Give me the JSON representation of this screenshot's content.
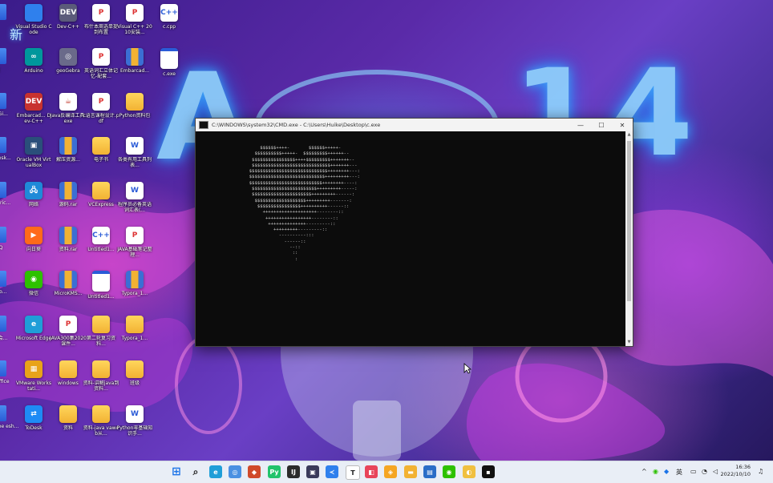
{
  "desktop": {
    "decorative_text": "新",
    "icons": [
      {
        "label": "Visual Studio Code",
        "icon": "vscode-icon",
        "color": "#2f80ed"
      },
      {
        "label": "Dev-C++",
        "icon": "devcpp-icon",
        "color": "#5b5b7a",
        "glyph": "DEV"
      },
      {
        "label": "布什本周选单提到布置",
        "icon": "pdf-document-icon",
        "color": "#ffffff",
        "glyph": "P"
      },
      {
        "label": "Visual C++ 2010安装...",
        "icon": "pdf-document-icon",
        "color": "#ffffff",
        "glyph": "P"
      },
      {
        "label": "c.cpp",
        "icon": "cpp-file-icon",
        "color": "#ffffff",
        "glyph": "C++"
      },
      {
        "label": "Arduino",
        "icon": "arduino-icon",
        "color": "#00979c",
        "glyph": "∞"
      },
      {
        "label": "geoGebra",
        "icon": "geogebra-icon",
        "color": "#6a6a8a",
        "glyph": "◎"
      },
      {
        "label": "英语词汇立体记忆-配套...",
        "icon": "pdf-document-icon",
        "color": "#ffffff",
        "glyph": "P"
      },
      {
        "label": "Embarcad...",
        "icon": "archive-icon",
        "color": "#3b6fd4"
      },
      {
        "label": "c.exe",
        "icon": "exe-icon",
        "color": "#ffffff"
      },
      {
        "label": "Embarcad... Dev-C++",
        "icon": "devcpp-icon",
        "color": "#c8322f",
        "glyph": "DEV"
      },
      {
        "label": "Java反编译工具.exe",
        "icon": "java-icon",
        "color": "#ffffff",
        "glyph": "☕"
      },
      {
        "label": "c语言课程设计.pdf",
        "icon": "pdf-document-icon",
        "color": "#ffffff",
        "glyph": "P"
      },
      {
        "label": "Python资料包",
        "icon": "folder-icon",
        "color": "#f2b233"
      },
      {
        "label": "Oracle VM VirtualBox",
        "icon": "virtualbox-icon",
        "color": "#2a4f7a",
        "glyph": "▣"
      },
      {
        "label": "解压资源...",
        "icon": "archive-icon",
        "color": "#3b6fd4"
      },
      {
        "label": "电子书",
        "icon": "folder-icon",
        "color": "#f2b233"
      },
      {
        "label": "各类有用工具列表...",
        "icon": "word-document-icon",
        "color": "#ffffff",
        "glyph": "W"
      },
      {
        "label": "网络",
        "icon": "network-icon",
        "color": "#1f8ad8",
        "glyph": "🖧"
      },
      {
        "label": "源码.rar",
        "icon": "archive-icon",
        "color": "#3b6fd4"
      },
      {
        "label": "VCExpress",
        "icon": "folder-icon",
        "color": "#f2b233"
      },
      {
        "label": "程序员必备英语词汇表(...",
        "icon": "word-document-icon",
        "color": "#ffffff",
        "glyph": "W"
      },
      {
        "label": "向日葵",
        "icon": "sunlogin-icon",
        "color": "#ff6a1a",
        "glyph": "▶"
      },
      {
        "label": "资料.rar",
        "icon": "archive-icon",
        "color": "#3b6fd4"
      },
      {
        "label": "Untitled1...",
        "icon": "cpp-file-icon",
        "color": "#ffffff",
        "glyph": "C++"
      },
      {
        "label": "JAVA基础笔记整理...",
        "icon": "pdf-document-icon",
        "color": "#ffffff",
        "glyph": "P"
      },
      {
        "label": "微信",
        "icon": "wechat-icon",
        "color": "#2dc100",
        "glyph": "◉"
      },
      {
        "label": "MicroKMS...",
        "icon": "archive-icon",
        "color": "#3b6fd4"
      },
      {
        "label": "Untitled1...",
        "icon": "exe-icon",
        "color": "#ffffff"
      },
      {
        "label": "Typora_1...",
        "icon": "archive-icon",
        "color": "#3b6fd4"
      },
      {
        "label": "Microsoft Edge",
        "icon": "edge-icon",
        "color": "#1f9ed8",
        "glyph": "e"
      },
      {
        "label": "JAVA300集2020课件...",
        "icon": "pdf-document-icon",
        "color": "#ffffff",
        "glyph": "P"
      },
      {
        "label": "第二轮复习资料...",
        "icon": "folder-icon",
        "color": "#f2b233"
      },
      {
        "label": "Typora_1...",
        "icon": "folder-icon",
        "color": "#f2b233"
      },
      {
        "label": "VMware Workstati...",
        "icon": "vmware-icon",
        "color": "#e8a31a",
        "glyph": "▦"
      },
      {
        "label": "windows",
        "icon": "folder-icon",
        "color": "#f2b233"
      },
      {
        "label": "资料-讲解java到资料...",
        "icon": "folder-icon",
        "color": "#f2b233"
      },
      {
        "label": "班级",
        "icon": "folder-icon",
        "color": "#f2b233"
      },
      {
        "label": "ToDesk",
        "icon": "todesk-icon",
        "color": "#1e8bf5",
        "glyph": "⇄"
      },
      {
        "label": "资料",
        "icon": "folder-icon",
        "color": "#f2b233"
      },
      {
        "label": "资料-java vaweb从...",
        "icon": "folder-icon",
        "color": "#f2b233"
      },
      {
        "label": "Python零基础知识手...",
        "icon": "word-document-icon",
        "color": "#ffffff",
        "glyph": "W"
      }
    ],
    "edge_labels": [
      "r",
      "剑",
      "dGi...",
      "desk...",
      "teric...",
      "QQ",
      "Mo...",
      "e会...",
      "Office",
      "obe esh..."
    ]
  },
  "console": {
    "title": "C:\\WINDOWS\\system32\\CMD.exe - C:\\Users\\Huike\\Desktop\\c.exe",
    "minimize": "—",
    "maximize": "☐",
    "close": "✕",
    "output_lines": [
      "      $$$$$$++++-       $$$$$$+++++-",
      "    $$$$$$$$$$+++++-  $$$$$$$$$++++++--",
      "   $$$$$$$$$$$$$$$$++++$$$$$$$$$+++++++--",
      "   $$$$$$$$$$$$$$$$$$$$$$$$$$$$$+++++++---",
      "  $$$$$$$$$$$$$$$$$$$$$$$$$$$$$++++++++---:",
      "  $$$$$$$$$$$$$$$$$$$$$$$$$$$$+++++++++---:",
      "  $$$$$$$$$$$$$$$$$$$$$$$$$$$++++++++----:",
      "   $$$$$$$$$$$$$$$$$$$$$$$$+++++++++-----:",
      "   $$$$$$$$$$$$$$$$$$$$$$+++++++++------:",
      "    $$$$$$$$$$$$$$$$$$$+++++++++-------:",
      "     $$$$$$$$$$$$$$$$++++++++++------::",
      "       ++++++++++++++++++++--------::",
      "        +++++++++++++++++--------::",
      "         ++++++++++++++---------::",
      "           +++++++++---------::",
      "             ----------:::",
      "               ------::",
      "                 --::",
      "                  ::",
      "                   :"
    ]
  },
  "taskbar": {
    "apps": [
      {
        "name": "start-button",
        "glyph": "⊞",
        "color": "#1a73e8"
      },
      {
        "name": "search",
        "glyph": "⌕",
        "color": "#333333"
      },
      {
        "name": "edge",
        "glyph": "e",
        "color": "#1f9ed8"
      },
      {
        "name": "browser",
        "glyph": "◎",
        "color": "#4a90e2"
      },
      {
        "name": "app",
        "glyph": "◆",
        "color": "#d04a2a"
      },
      {
        "name": "pycharm",
        "glyph": "Py",
        "color": "#21c36b"
      },
      {
        "name": "intellij",
        "glyph": "IJ",
        "color": "#2b2b2b"
      },
      {
        "name": "app",
        "glyph": "▣",
        "color": "#3a3a5a"
      },
      {
        "name": "vscode",
        "glyph": "≺",
        "color": "#2f80ed"
      },
      {
        "name": "typora",
        "glyph": "T",
        "color": "#ffffff"
      },
      {
        "name": "app",
        "glyph": "◧",
        "color": "#e8445a"
      },
      {
        "name": "app",
        "glyph": "◈",
        "color": "#f5a623"
      },
      {
        "name": "file-explorer",
        "glyph": "▬",
        "color": "#f2b233"
      },
      {
        "name": "app",
        "glyph": "▤",
        "color": "#2a6dc7"
      },
      {
        "name": "wechat",
        "glyph": "◉",
        "color": "#2dc100"
      },
      {
        "name": "app",
        "glyph": "◐",
        "color": "#f0c040"
      },
      {
        "name": "terminal",
        "glyph": "▪",
        "color": "#111111"
      }
    ],
    "tray": {
      "chevron": "^",
      "ime": "英",
      "clock_time": "16:36",
      "clock_date": "2022/10/10"
    }
  }
}
